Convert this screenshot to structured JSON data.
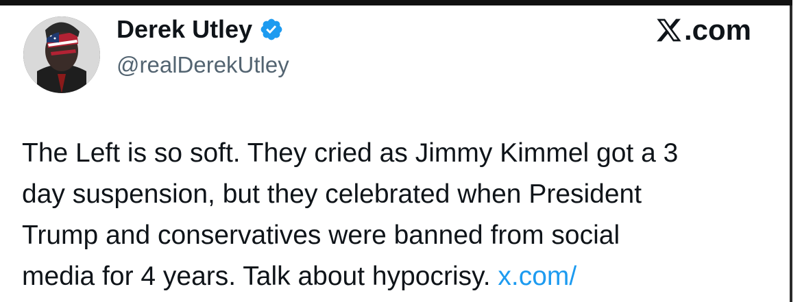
{
  "tweet": {
    "author": {
      "display_name": "Derek Utley",
      "handle": "@realDerekUtley",
      "verified_icon": "verified-badge-icon",
      "avatar": "profile-photo"
    },
    "brand_label": ".com",
    "brand_icon": "x-logo-icon",
    "lines": [
      "The Left is so soft. They cried as Jimmy Kimmel got a 3",
      "day suspension, but they celebrated when President",
      "Trump and conservatives were banned from social",
      "media for 4 years. Talk about hypocrisy."
    ],
    "link_text": "x.com/"
  },
  "colors": {
    "text": "#0f1419",
    "secondary": "#536471",
    "link": "#1d9bf0",
    "verified": "#1d9bf0"
  }
}
